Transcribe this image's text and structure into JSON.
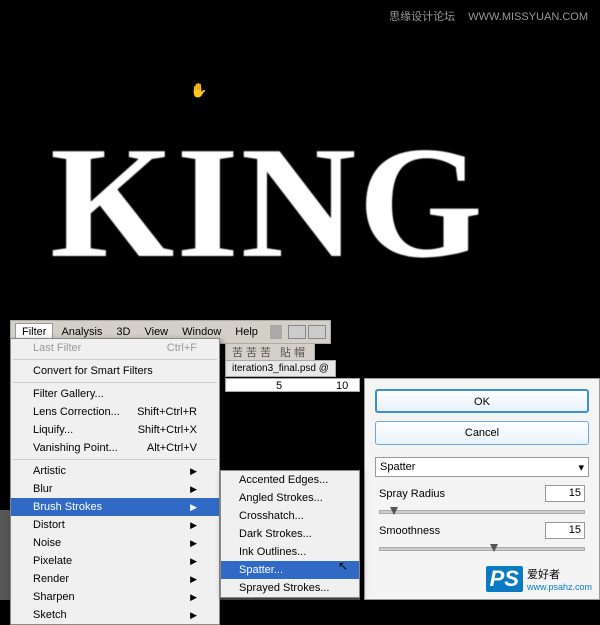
{
  "watermark_top": {
    "cn": "思缘设计论坛",
    "url": "WWW.MISSYUAN.COM"
  },
  "canvas_text": "KING",
  "menubar": {
    "items": [
      "Filter",
      "Analysis",
      "3D",
      "View",
      "Window",
      "Help"
    ]
  },
  "tabbar": {
    "icons": "苦苦苦 貼帽"
  },
  "docname": "iteration3_final.psd @",
  "ruler": {
    "a": "5",
    "b": "10"
  },
  "filter_menu": {
    "last_filter": {
      "label": "Last Filter",
      "shortcut": "Ctrl+F"
    },
    "convert": "Convert for Smart Filters",
    "gallery": "Filter Gallery...",
    "lens": {
      "label": "Lens Correction...",
      "shortcut": "Shift+Ctrl+R"
    },
    "liquify": {
      "label": "Liquify...",
      "shortcut": "Shift+Ctrl+X"
    },
    "vanish": {
      "label": "Vanishing Point...",
      "shortcut": "Alt+Ctrl+V"
    },
    "groups": [
      "Artistic",
      "Blur",
      "Brush Strokes",
      "Distort",
      "Noise",
      "Pixelate",
      "Render",
      "Sharpen",
      "Sketch"
    ]
  },
  "submenu": {
    "items": [
      "Accented Edges...",
      "Angled Strokes...",
      "Crosshatch...",
      "Dark Strokes...",
      "Ink Outlines...",
      "Spatter...",
      "Sprayed Strokes..."
    ]
  },
  "dialog": {
    "ok": "OK",
    "cancel": "Cancel",
    "select": "Spatter",
    "spray": {
      "label": "Spray Radius",
      "value": "15",
      "pos": 10
    },
    "smooth": {
      "label": "Smoothness",
      "value": "15",
      "pos": 110
    }
  },
  "watermark_bottom": {
    "ps": "PS",
    "cn": "爱好者",
    "url": "www.psahz.com"
  }
}
